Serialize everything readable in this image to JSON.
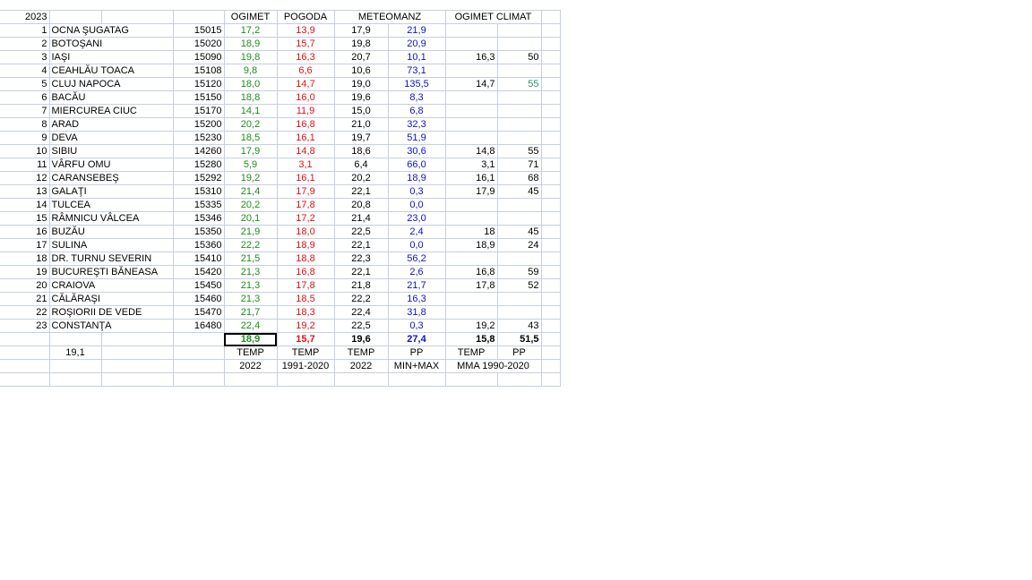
{
  "sheet": {
    "year": "2023",
    "headers": {
      "ogimet": "OGIMET",
      "pogoda": "POGODA",
      "meteomanz": "METEOMANZ",
      "ogimet_climat": "OGIMET CLIMAT"
    },
    "rows": [
      {
        "n": "1",
        "name": "OCNA ŞUGATAG",
        "code": "15015",
        "ogimet": "17,2",
        "pogoda": "13,9",
        "mm_temp": "17,9",
        "mm_pp": "21,9",
        "cl_temp": "",
        "cl_pp": ""
      },
      {
        "n": "2",
        "name": "BOTOŞANI",
        "code": "15020",
        "ogimet": "18,9",
        "pogoda": "15,7",
        "mm_temp": "19,8",
        "mm_pp": "20,9",
        "cl_temp": "",
        "cl_pp": ""
      },
      {
        "n": "3",
        "name": "IAŞI",
        "code": "15090",
        "ogimet": "19,8",
        "pogoda": "16,3",
        "mm_temp": "20,7",
        "mm_pp": "10,1",
        "cl_temp": "16,3",
        "cl_pp": "50"
      },
      {
        "n": "4",
        "name": "CEAHLĂU TOACA",
        "code": "15108",
        "ogimet": "9,8",
        "pogoda": "6,6",
        "mm_temp": "10,6",
        "mm_pp": "73,1",
        "cl_temp": "",
        "cl_pp": ""
      },
      {
        "n": "5",
        "name": "CLUJ NAPOCA",
        "code": "15120",
        "ogimet": "18,0",
        "pogoda": "14,7",
        "mm_temp": "19,0",
        "mm_pp": "135,5",
        "cl_temp": "14,7",
        "cl_pp": "55"
      },
      {
        "n": "6",
        "name": "BACĂU",
        "code": "15150",
        "ogimet": "18,8",
        "pogoda": "16,0",
        "mm_temp": "19,6",
        "mm_pp": "8,3",
        "cl_temp": "",
        "cl_pp": ""
      },
      {
        "n": "7",
        "name": "MIERCUREA CIUC",
        "code": "15170",
        "ogimet": "14,1",
        "pogoda": "11,9",
        "mm_temp": "15,0",
        "mm_pp": "6,8",
        "cl_temp": "",
        "cl_pp": ""
      },
      {
        "n": "8",
        "name": "ARAD",
        "code": "15200",
        "ogimet": "20,2",
        "pogoda": "16,8",
        "mm_temp": "21,0",
        "mm_pp": "32,3",
        "cl_temp": "",
        "cl_pp": ""
      },
      {
        "n": "9",
        "name": "DEVA",
        "code": "15230",
        "ogimet": "18,5",
        "pogoda": "16,1",
        "mm_temp": "19,7",
        "mm_pp": "51,9",
        "cl_temp": "",
        "cl_pp": ""
      },
      {
        "n": "10",
        "name": "SIBIU",
        "code": "14260",
        "ogimet": "17,9",
        "pogoda": "14,8",
        "mm_temp": "18,6",
        "mm_pp": "30,6",
        "cl_temp": "14,8",
        "cl_pp": "55"
      },
      {
        "n": "11",
        "name": "VÂRFU OMU",
        "code": "15280",
        "ogimet": "5,9",
        "pogoda": "3,1",
        "mm_temp": "6,4",
        "mm_pp": "66,0",
        "cl_temp": "3,1",
        "cl_pp": "71"
      },
      {
        "n": "12",
        "name": "CARANSEBEŞ",
        "code": "15292",
        "ogimet": "19,2",
        "pogoda": "16,1",
        "mm_temp": "20,2",
        "mm_pp": "18,9",
        "cl_temp": "16,1",
        "cl_pp": "68"
      },
      {
        "n": "13",
        "name": "GALAŢI",
        "code": "15310",
        "ogimet": "21,4",
        "pogoda": "17,9",
        "mm_temp": "22,1",
        "mm_pp": "0,3",
        "cl_temp": "17,9",
        "cl_pp": "45"
      },
      {
        "n": "14",
        "name": "TULCEA",
        "code": "15335",
        "ogimet": "20,2",
        "pogoda": "17,8",
        "mm_temp": "20,8",
        "mm_pp": "0,0",
        "cl_temp": "",
        "cl_pp": ""
      },
      {
        "n": "15",
        "name": "RÂMNICU VÂLCEA",
        "code": "15346",
        "ogimet": "20,1",
        "pogoda": "17,2",
        "mm_temp": "21,4",
        "mm_pp": "23,0",
        "cl_temp": "",
        "cl_pp": ""
      },
      {
        "n": "16",
        "name": "BUZĂU",
        "code": "15350",
        "ogimet": "21,9",
        "pogoda": "18,0",
        "mm_temp": "22,5",
        "mm_pp": "2,4",
        "cl_temp": "18",
        "cl_pp": "45"
      },
      {
        "n": "17",
        "name": "SULINA",
        "code": "15360",
        "ogimet": "22,2",
        "pogoda": "18,9",
        "mm_temp": "22,1",
        "mm_pp": "0,0",
        "cl_temp": "18,9",
        "cl_pp": "24"
      },
      {
        "n": "18",
        "name": "DR. TURNU SEVERIN",
        "code": "15410",
        "ogimet": "21,5",
        "pogoda": "18,8",
        "mm_temp": "22,3",
        "mm_pp": "56,2",
        "cl_temp": "",
        "cl_pp": ""
      },
      {
        "n": "19",
        "name": "BUCUREŞTI BĂNEASA",
        "code": "15420",
        "ogimet": "21,3",
        "pogoda": "16,8",
        "mm_temp": "22,1",
        "mm_pp": "2,6",
        "cl_temp": "16,8",
        "cl_pp": "59"
      },
      {
        "n": "20",
        "name": "CRAIOVA",
        "code": "15450",
        "ogimet": "21,3",
        "pogoda": "17,8",
        "mm_temp": "21,8",
        "mm_pp": "21,7",
        "cl_temp": "17,8",
        "cl_pp": "52"
      },
      {
        "n": "21",
        "name": "CĂLĂRAŞI",
        "code": "15460",
        "ogimet": "21,3",
        "pogoda": "18,5",
        "mm_temp": "22,2",
        "mm_pp": "16,3",
        "cl_temp": "",
        "cl_pp": ""
      },
      {
        "n": "22",
        "name": "ROŞIORII DE VEDE",
        "code": "15470",
        "ogimet": "21,7",
        "pogoda": "18,3",
        "mm_temp": "22,4",
        "mm_pp": "31,8",
        "cl_temp": "",
        "cl_pp": ""
      },
      {
        "n": "23",
        "name": "CONSTANŢA",
        "code": "16480",
        "ogimet": "22,4",
        "pogoda": "19,2",
        "mm_temp": "22,5",
        "mm_pp": "0,3",
        "cl_temp": "19,2",
        "cl_pp": "43"
      }
    ],
    "totals": {
      "ogimet": "18,9",
      "pogoda": "15,7",
      "mm_temp": "19,6",
      "mm_pp": "27,4",
      "cl_temp": "15,8",
      "cl_pp": "51,5"
    },
    "aside_value": "19,1",
    "labels1": {
      "ogimet": "TEMP",
      "pogoda": "TEMP",
      "mm_temp": "TEMP",
      "mm_pp": "PP",
      "cl_temp": "TEMP",
      "cl_pp": "PP"
    },
    "labels2": {
      "ogimet": "2022",
      "pogoda": "1991-2020",
      "mm_temp": "2022",
      "mm_pp": "MIN+MAX",
      "climat": "MMA 1990-2020"
    },
    "colors": {
      "green": "#1a8f1a",
      "red": "#e01010",
      "blue": "#1010c8",
      "teal": "#1f9a6a",
      "grid": "#c6d0e0"
    }
  }
}
